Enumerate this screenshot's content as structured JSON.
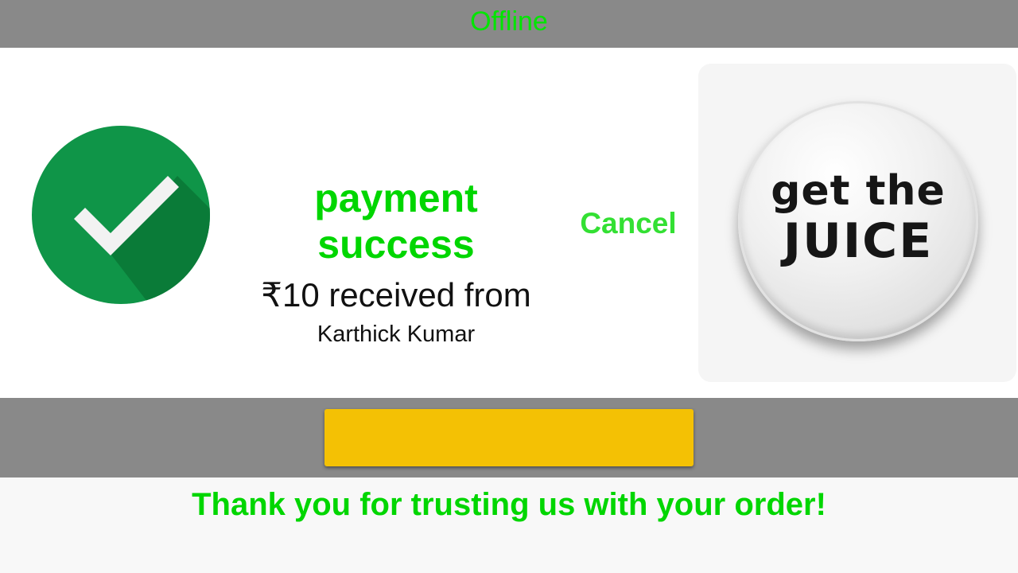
{
  "status_bar": {
    "text": "Offline",
    "color": "#00e600"
  },
  "payment": {
    "status_icon": "check-circle-icon",
    "title": "payment success",
    "amount_text": "₹10 received from",
    "sender_name": "Karthick Kumar"
  },
  "actions": {
    "cancel_label": "Cancel",
    "primary_button_label": ""
  },
  "logo": {
    "line1": "get the",
    "line2": "JUICE"
  },
  "footer": {
    "message": "Thank you for trusting us with your order!"
  },
  "colors": {
    "accent_green": "#00d600",
    "check_green": "#0f9548",
    "button_yellow": "#f4c104",
    "bar_gray": "#898989"
  }
}
